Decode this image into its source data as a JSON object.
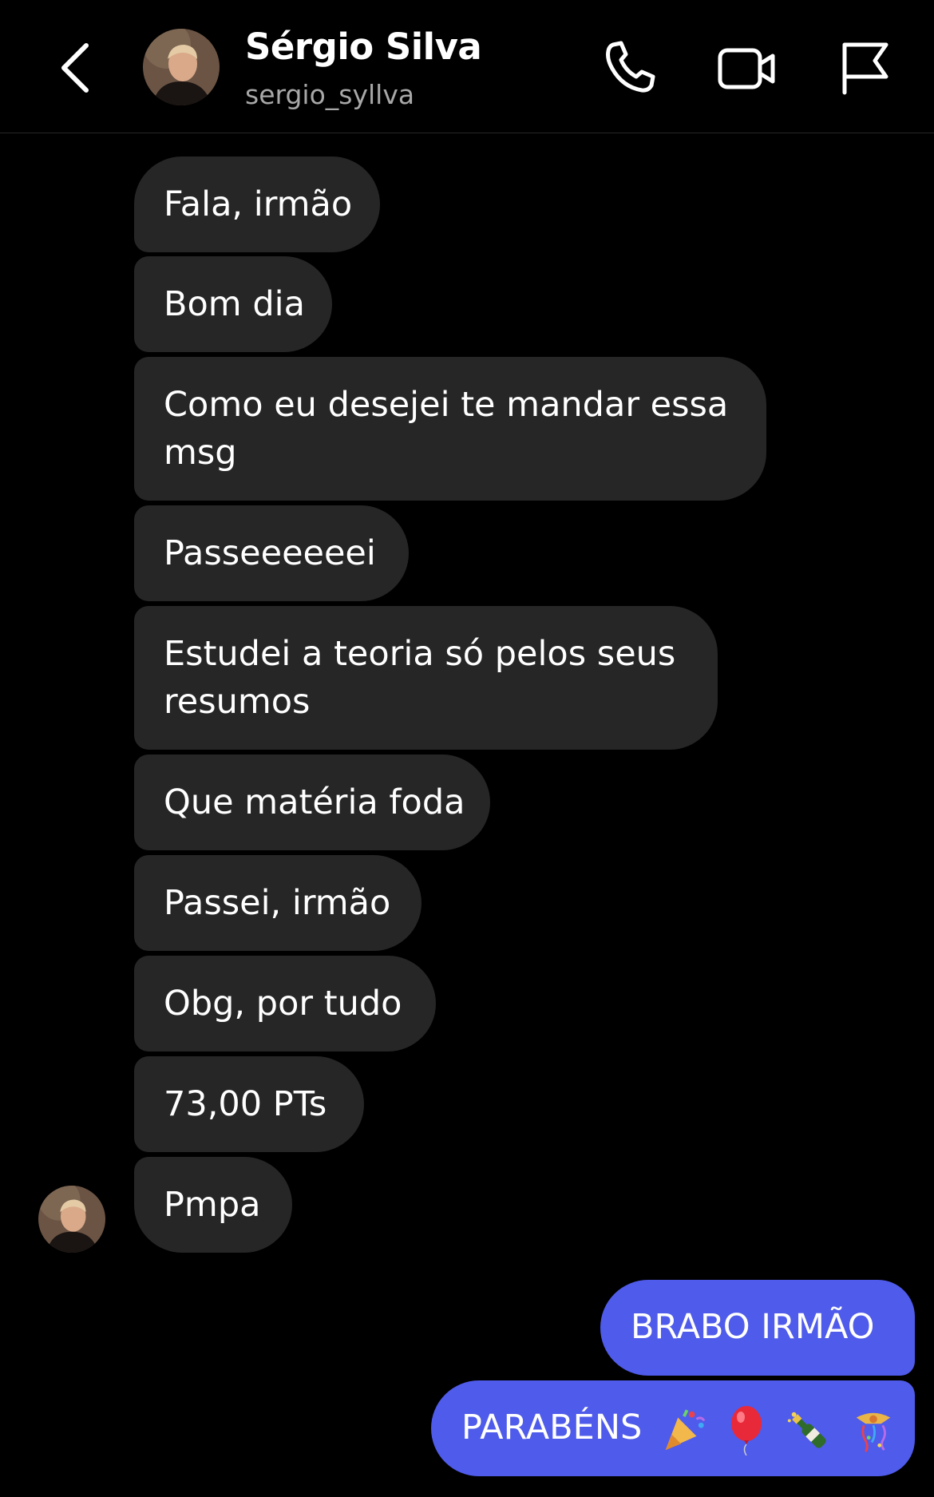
{
  "header": {
    "contact_name": "Sérgio Silva",
    "username": "sergio_syllva",
    "icons": [
      "chevron-left-icon",
      "phone-icon",
      "video-camera-icon",
      "flag-icon"
    ]
  },
  "messages": {
    "incoming": [
      {
        "text": "Fala, irmão"
      },
      {
        "text": "Bom dia"
      },
      {
        "text": "Como eu desejei te mandar essa msg"
      },
      {
        "text": "Passeeeeeei"
      },
      {
        "text": "Estudei a teoria só pelos seus resumos"
      },
      {
        "text": "Que matéria foda"
      },
      {
        "text": "Passei, irmão"
      },
      {
        "text": "Obg, por tudo"
      },
      {
        "text": "73,00 PTs"
      },
      {
        "text": "Pmpa"
      }
    ],
    "outgoing": [
      {
        "text": "BRABO IRMÃO"
      },
      {
        "text": "PARABÉNS",
        "emojis": [
          "party-popper-icon",
          "balloon-icon",
          "champagne-bottle-icon",
          "confetti-ball-icon"
        ]
      }
    ]
  },
  "colors": {
    "background": "#000000",
    "incoming_bubble": "#262626",
    "outgoing_bubble": "#4f5bea",
    "secondary_text": "#a8a8a8"
  }
}
